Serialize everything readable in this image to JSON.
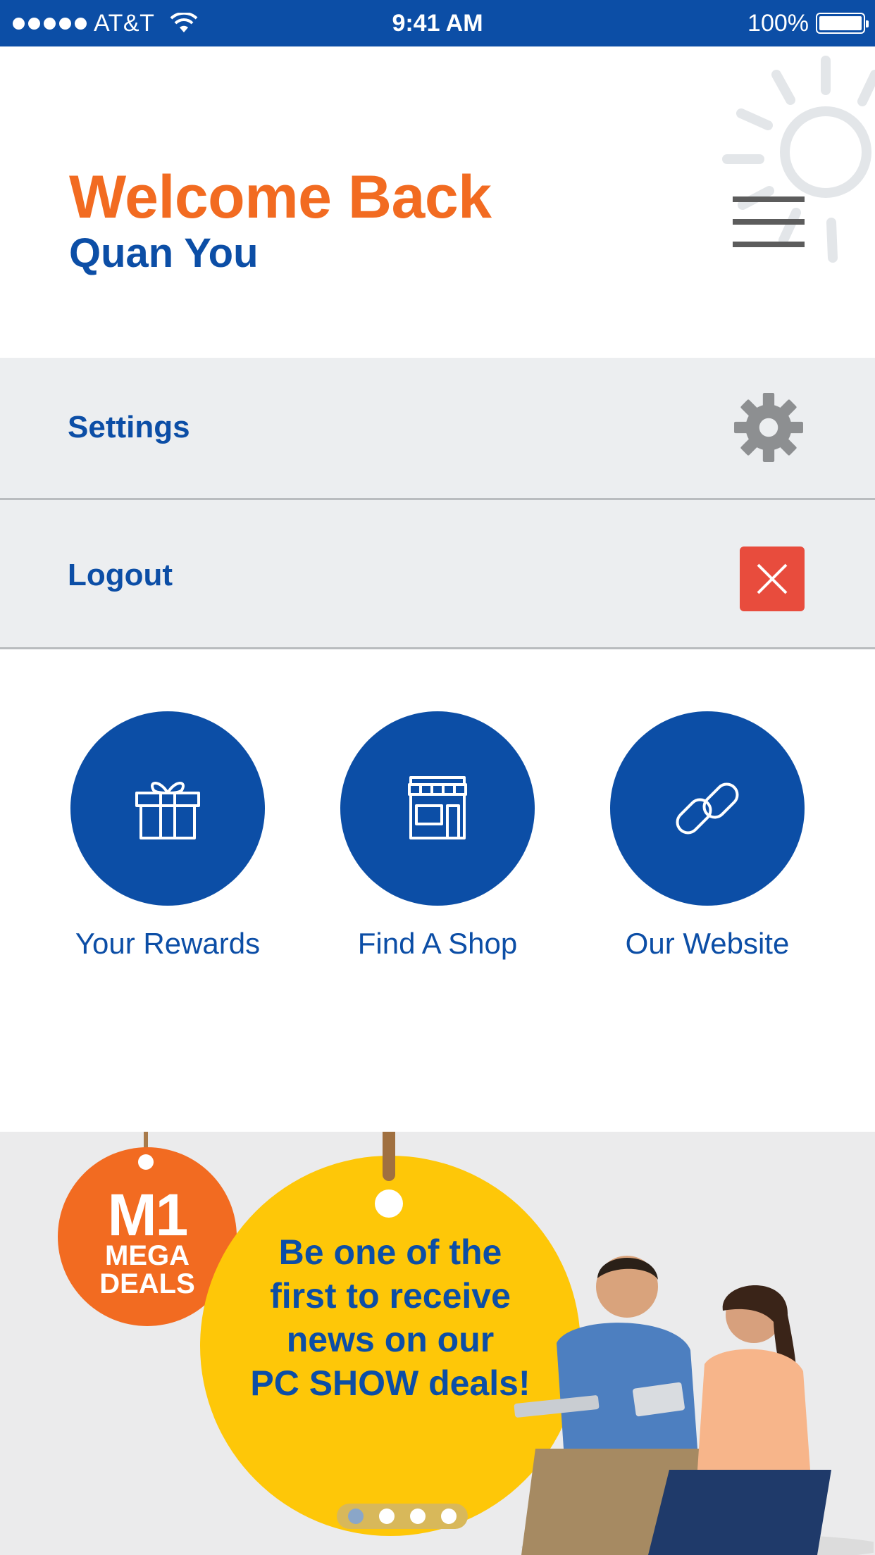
{
  "status_bar": {
    "carrier": "AT&T",
    "time": "9:41 AM",
    "battery": "100%"
  },
  "header": {
    "title": "Welcome Back",
    "user_name": "Quan You"
  },
  "menu": {
    "settings_label": "Settings",
    "logout_label": "Logout"
  },
  "actions": [
    {
      "label": "Your Rewards",
      "icon": "gift-icon"
    },
    {
      "label": "Find A Shop",
      "icon": "shop-icon"
    },
    {
      "label": "Our Website",
      "icon": "link-icon"
    }
  ],
  "banner": {
    "tag_big": "M1",
    "tag_line1": "MEGA",
    "tag_line2": "DEALS",
    "promo_line1": "Be one of the",
    "promo_line2": "first to receive",
    "promo_line3": "news on our",
    "promo_line4": "PC SHOW deals!",
    "carousel_pages": 4,
    "carousel_active_index": 0
  },
  "colors": {
    "brand_blue": "#0c4ea6",
    "brand_orange": "#f26b21",
    "logout_red": "#e84c3d",
    "promo_yellow": "#fec708"
  }
}
